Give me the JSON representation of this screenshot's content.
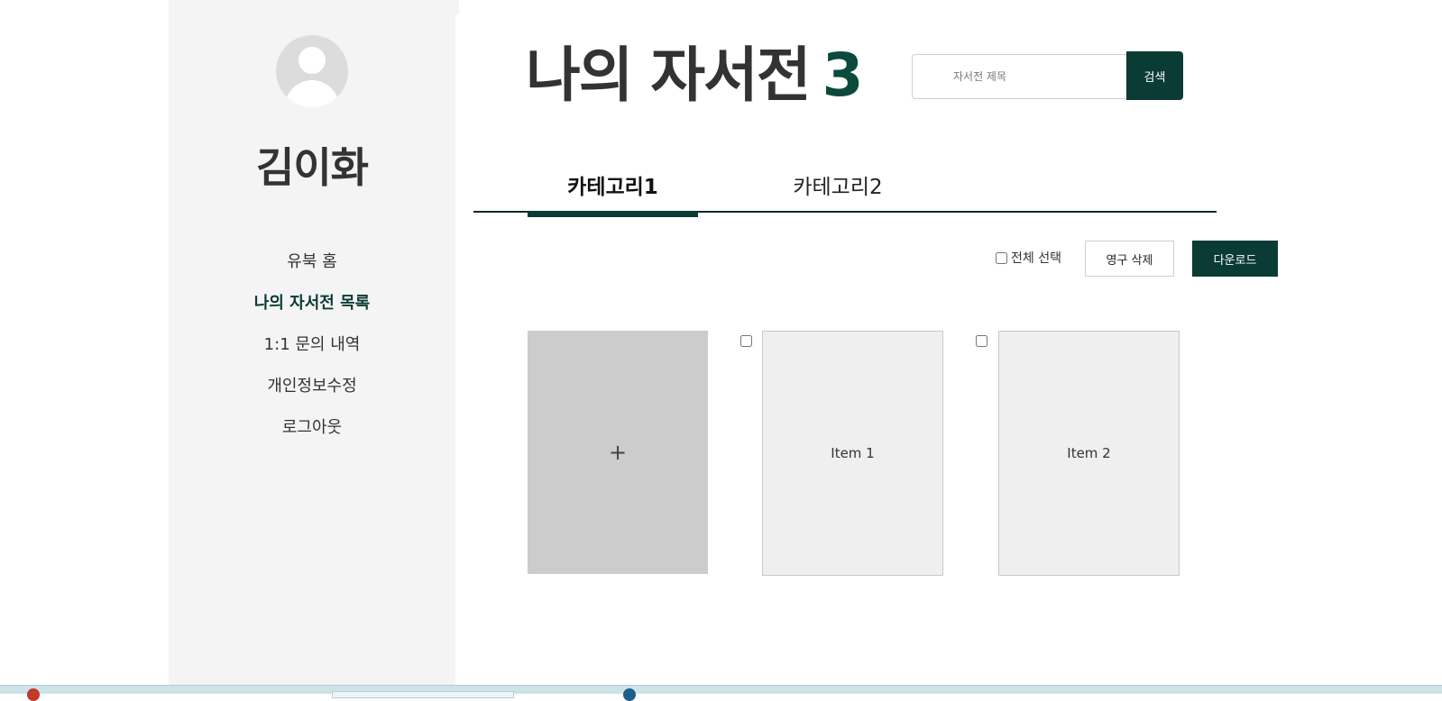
{
  "sidebar": {
    "username": "김이화",
    "items": [
      {
        "label": "유북 홈"
      },
      {
        "label": "나의 자서전 목록"
      },
      {
        "label": "1:1 문의 내역"
      },
      {
        "label": "개인정보수정"
      },
      {
        "label": "로그아웃"
      }
    ],
    "active_index": 1
  },
  "header": {
    "title": "나의 자서전",
    "count": "3"
  },
  "search": {
    "placeholder": "자서전 제목",
    "button_label": "검색"
  },
  "tabs": [
    {
      "label": "카테고리1",
      "active": true
    },
    {
      "label": "카테고리2",
      "active": false
    }
  ],
  "toolbar": {
    "select_all_label": "전체 선택",
    "delete_label": "영구 삭제",
    "download_label": "다운로드"
  },
  "add_card": {
    "symbol": "+"
  },
  "items": [
    {
      "label": "Item 1"
    },
    {
      "label": "Item 2"
    }
  ],
  "colors": {
    "accent": "#0b3b35",
    "sidebar_bg": "#f4f4f4",
    "card_bg": "#efefef",
    "add_card_bg": "#cccccc"
  }
}
